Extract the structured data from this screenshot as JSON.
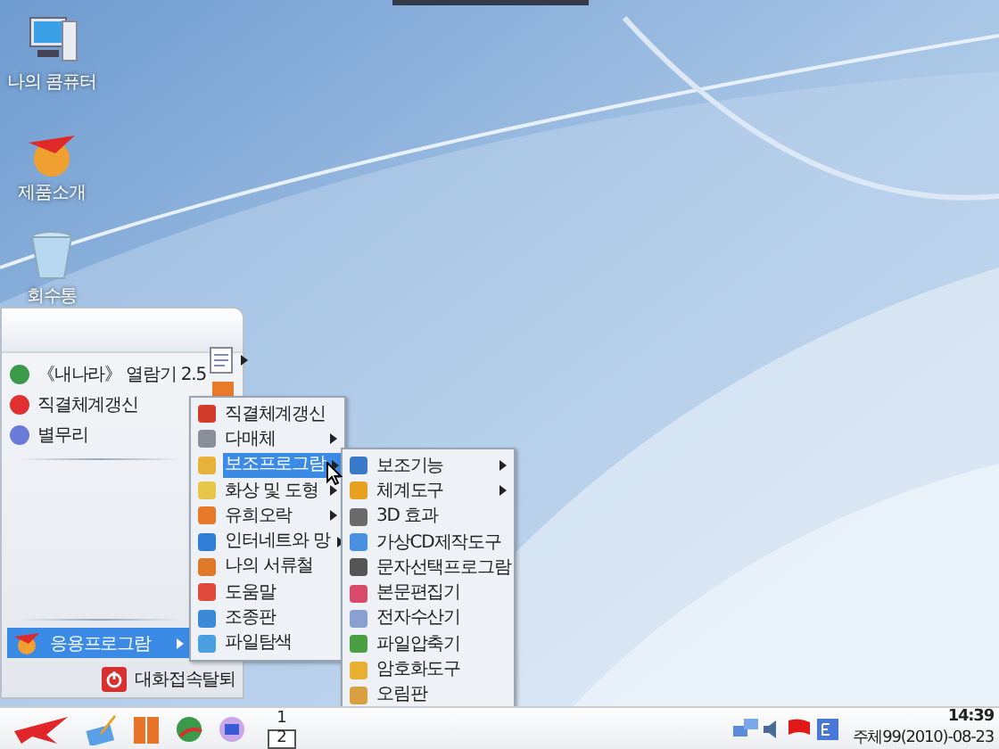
{
  "desktop_icons": [
    {
      "label": "나의 콤퓨터",
      "kind": "computer"
    },
    {
      "label": "제품소개",
      "kind": "product"
    },
    {
      "label": "회수통",
      "kind": "trash"
    }
  ],
  "start_menu": {
    "pinned": [
      {
        "label": "《내나라》 열람기 2.5"
      },
      {
        "label": "직결체계갱신"
      },
      {
        "label": "별무리"
      }
    ],
    "programs_item": {
      "label": "응용프로그람",
      "selected": true
    },
    "logout": {
      "label": "대화접속탈퇴"
    }
  },
  "submenus": [
    {
      "items": [
        {
          "label": "직결체계갱신",
          "has_submenu": false,
          "selected": false
        },
        {
          "label": "다매체",
          "has_submenu": true,
          "selected": false
        },
        {
          "label": "보조프로그람",
          "has_submenu": true,
          "selected": true
        },
        {
          "label": "화상 및 도형",
          "has_submenu": true,
          "selected": false
        },
        {
          "label": "유희오락",
          "has_submenu": true,
          "selected": false
        },
        {
          "label": "인터네트와 망",
          "has_submenu": true,
          "selected": false
        },
        {
          "label": "나의 서류철",
          "has_submenu": false,
          "selected": false
        },
        {
          "label": "도움말",
          "has_submenu": false,
          "selected": false
        },
        {
          "label": "조종판",
          "has_submenu": false,
          "selected": false
        },
        {
          "label": "파일탐색",
          "has_submenu": false,
          "selected": false
        }
      ]
    },
    {
      "items": [
        {
          "label": "보조기능",
          "has_submenu": true,
          "selected": false
        },
        {
          "label": "체계도구",
          "has_submenu": true,
          "selected": false
        },
        {
          "label": "3D 효과",
          "has_submenu": false,
          "selected": false
        },
        {
          "label": "가상CD제작도구",
          "has_submenu": false,
          "selected": false
        },
        {
          "label": "문자선택프로그람",
          "has_submenu": false,
          "selected": false
        },
        {
          "label": "본문편집기",
          "has_submenu": false,
          "selected": false
        },
        {
          "label": "전자수산기",
          "has_submenu": false,
          "selected": false
        },
        {
          "label": "파일압축기",
          "has_submenu": false,
          "selected": false
        },
        {
          "label": "암호화도구",
          "has_submenu": false,
          "selected": false
        },
        {
          "label": "오림판",
          "has_submenu": false,
          "selected": false
        }
      ]
    }
  ],
  "taskbar": {
    "workspaces": [
      {
        "label": "1",
        "selected": false
      },
      {
        "label": "2",
        "selected": true
      }
    ],
    "clock": {
      "time": "14:39",
      "date": "주체99(2010)-08-23"
    }
  }
}
